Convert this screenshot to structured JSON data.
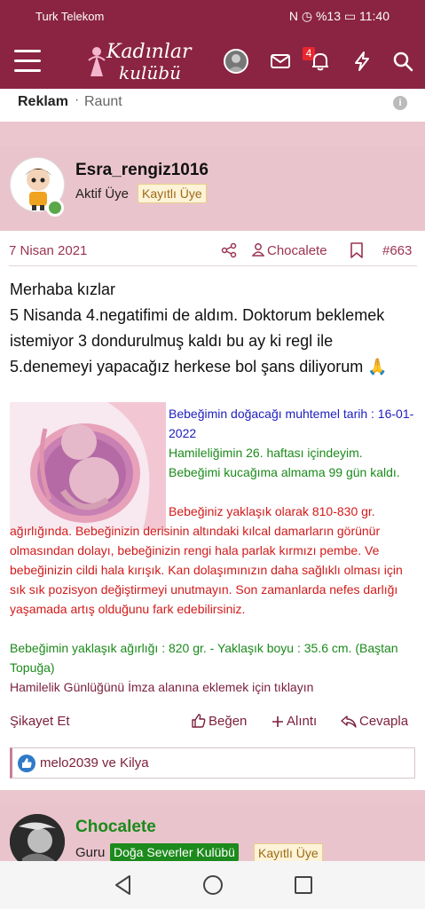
{
  "status_bar": {
    "carrier": "Turk Telekom",
    "right_text": "N ◷ %13 ▭ 11:40"
  },
  "header": {
    "logo_line1": "Kadınlar",
    "logo_line2": "kulübü",
    "notification_count": "4",
    "icons": [
      "menu-icon",
      "envelope-icon",
      "bell-icon",
      "bolt-icon",
      "search-icon"
    ]
  },
  "ad": {
    "label": "Reklam",
    "separator": "·",
    "brand": "Raunt",
    "info": "i"
  },
  "post": {
    "username": "Esra_rengiz1016",
    "role": "Aktif Üye",
    "tag": "Kayıtlı Üye",
    "date": "7 Nisan 2021",
    "quoted_user": "Chocalete",
    "post_number": "#663",
    "text": "Merhaba kızlar\n5 Nisanda 4.negatifimi de aldım. Doktorum beklemek istemiyor 3 dondurulmuş kaldı bu ay ki regl ile 5.denemeyi yapacağız herkese bol şans diliyorum 🙏",
    "signature": {
      "blue": "Bebeğimin doğacağı muhtemel tarih : 16-01-2022",
      "green1": "Hamileliğimin 26. haftası içindeyim. Bebeğimi kucağıma almama 99 gün kaldı.",
      "red": "Bebeğiniz yaklaşık olarak 810-830 gr. ağırlığında. Bebeğinizin derisinin altındaki kılcal damarların görünür olmasından dolayı, bebeğinizin rengi hala parlak kırmızı pembe. Ve bebeğinizin cildi hala kırışık. Kan dolaşımınızın daha sağlıklı olması için sık sık pozisyon değiştirmeyi unutmayın. Son zamanlarda nefes darlığı yaşamada artış olduğunu fark edebilirsiniz.",
      "green2": "Bebeğimin yaklaşık ağırlığı : 820 gr. - Yaklaşık boyu : 35.6 cm. (Baştan Topuğa)",
      "link": "Hamilelik Günlüğünü İmza alanına eklemek için tıklayın"
    },
    "actions": {
      "report": "Şikayet Et",
      "like": "Beğen",
      "quote": "Alıntı",
      "reply": "Cevapla"
    },
    "likes_text": "melo2039 ve Kilya"
  },
  "next_post": {
    "username": "Chocalete",
    "role": "Guru",
    "group_tag": "Doğa Severler Kulübü",
    "tag": "Kayıtlı Üye"
  },
  "colors": {
    "header_bg": "#8a2442",
    "page_bg": "#ecc6cf",
    "accent": "#9a3351",
    "signature_blue": "#2020c0",
    "signature_green": "#1b8a1b",
    "signature_red": "#d21a1a"
  }
}
